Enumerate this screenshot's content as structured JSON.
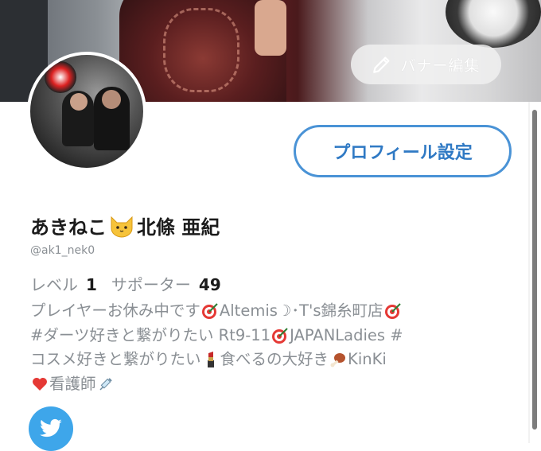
{
  "banner": {
    "edit_label": "バナー編集"
  },
  "profile": {
    "edit_button_label": "プロフィール設定",
    "name_part1": "あきねこ",
    "name_part2": "北條 亜紀",
    "handle": "@ak1_nek0"
  },
  "stats": {
    "level_label": "レベル",
    "level_value": "1",
    "supporter_label": "サポーター",
    "supporter_value": "49"
  },
  "bio": {
    "line1_a": "プレイヤーお休み中です",
    "line1_b": "Altemis☽･T's錦糸町店",
    "line2_a": "#ダーツ好きと繋がりたい Rt9-11",
    "line2_b": "JAPANLadies #",
    "line3_a": "コスメ好きと繋がりたい",
    "line3_b": " 食べるの大好き",
    "line3_c": "KinKi",
    "line4_a": "看護師"
  },
  "colors": {
    "accent": "#4a93d6",
    "twitter": "#3ea6ea",
    "muted_text": "#8a8f94"
  },
  "icons": [
    "pencil-icon",
    "cat-icon",
    "dart-icon",
    "lipstick-icon",
    "meat-icon",
    "heart-icon",
    "syringe-icon",
    "twitter-bird-icon"
  ]
}
